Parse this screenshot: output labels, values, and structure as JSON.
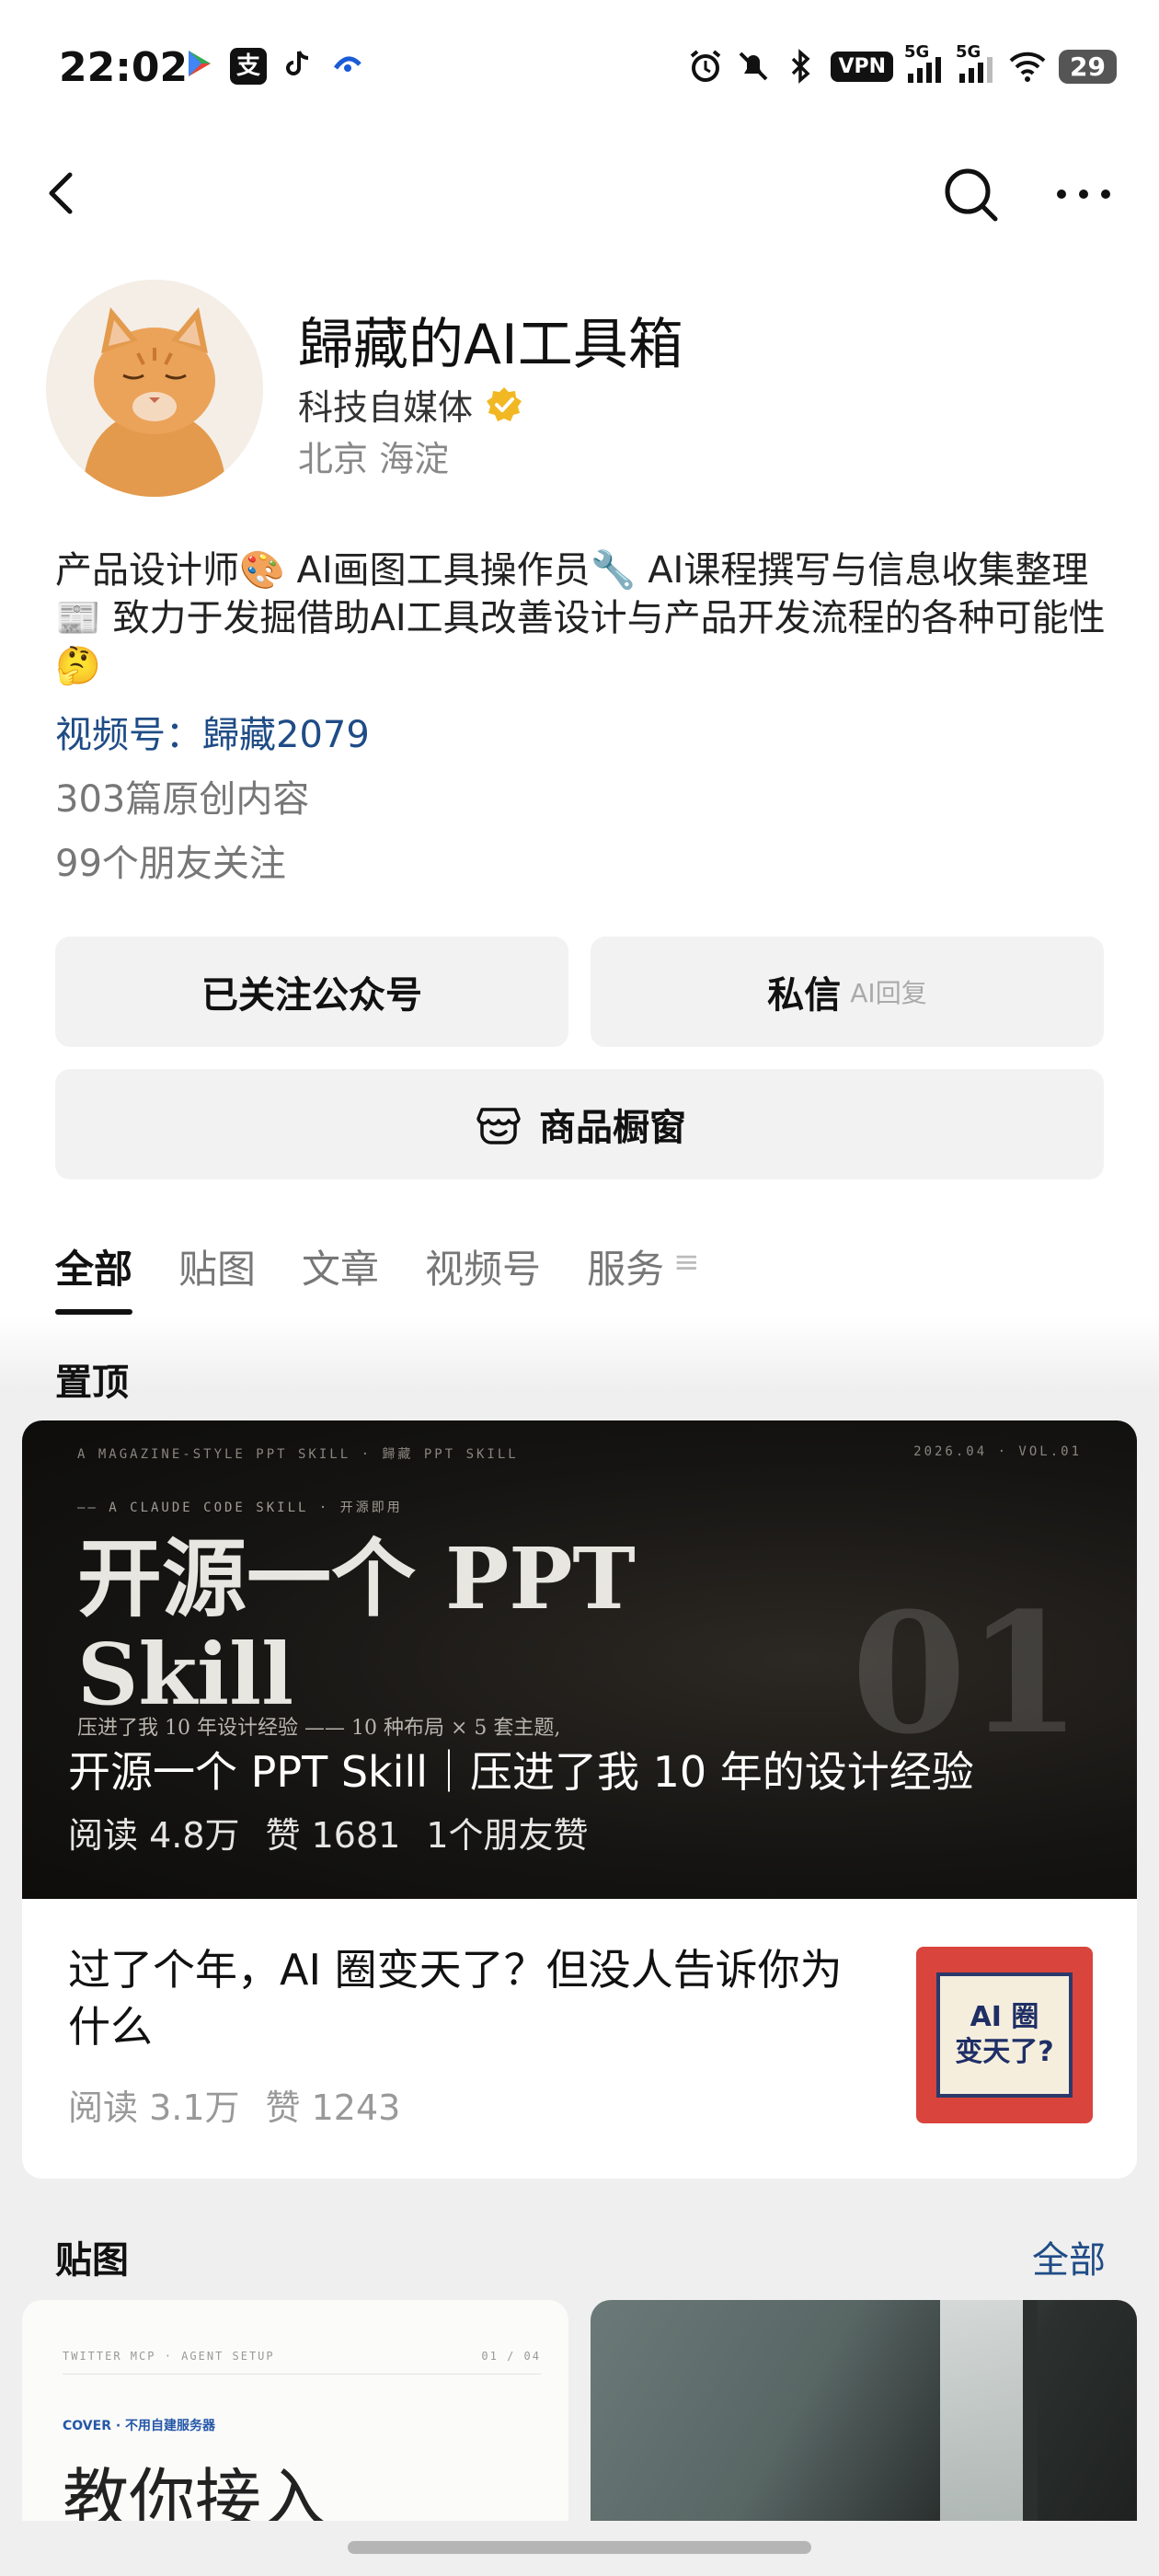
{
  "status_bar": {
    "time": "22:02",
    "vpn": "VPN",
    "signal1": "5G",
    "signal2": "5G",
    "battery": "29"
  },
  "profile": {
    "name": "歸藏的AI工具箱",
    "type": "科技自媒体",
    "location": "北京 海淀",
    "bio": "产品设计师🎨 AI画图工具操作员🔧 AI课程撰写与信息收集整理📰 致力于发掘借助AI工具改善设计与产品开发流程的各种可能性🤔",
    "channel": "视频号：歸藏2079",
    "original_count": "303篇原创内容",
    "friends_following": "99个朋友关注"
  },
  "actions": {
    "followed_label": "已关注公众号",
    "message_label": "私信",
    "message_sub": "AI回复",
    "shop_label": "商品橱窗"
  },
  "tabs": [
    "全部",
    "贴图",
    "文章",
    "视频号",
    "服务"
  ],
  "pinned": {
    "section_label": "置顶",
    "hero": {
      "top_left": "A MAGAZINE-STYLE PPT SKILL · 歸藏 PPT SKILL",
      "top_right": "2026.04 · VOL.01",
      "kicker": "—— A CLAUDE CODE SKILL · 开源即用",
      "big_text": "开源一个 PPT\nSkill",
      "number": "01",
      "subtext": "压进了我 10 年设计经验 —— 10 种布局 × 5 套主题,",
      "title": "开源一个 PPT Skill｜压进了我 10 年的设计经验",
      "reads": "阅读 4.8万",
      "likes": "赞 1681",
      "friends_liked": "1个朋友赞"
    },
    "article": {
      "title": "过了个年，AI 圈变天了？但没人告诉你为什么",
      "reads": "阅读 3.1万",
      "likes": "赞 1243",
      "thumb_text": "AI 圈\n变天了?"
    }
  },
  "posts": {
    "section_label": "贴图",
    "all_label": "全部",
    "left": {
      "meta_left": "TWITTER MCP · AGENT SETUP",
      "meta_right": "01 / 04",
      "cover_tag": "COVER · 不用自建服务器",
      "heading": "教你接入"
    }
  }
}
